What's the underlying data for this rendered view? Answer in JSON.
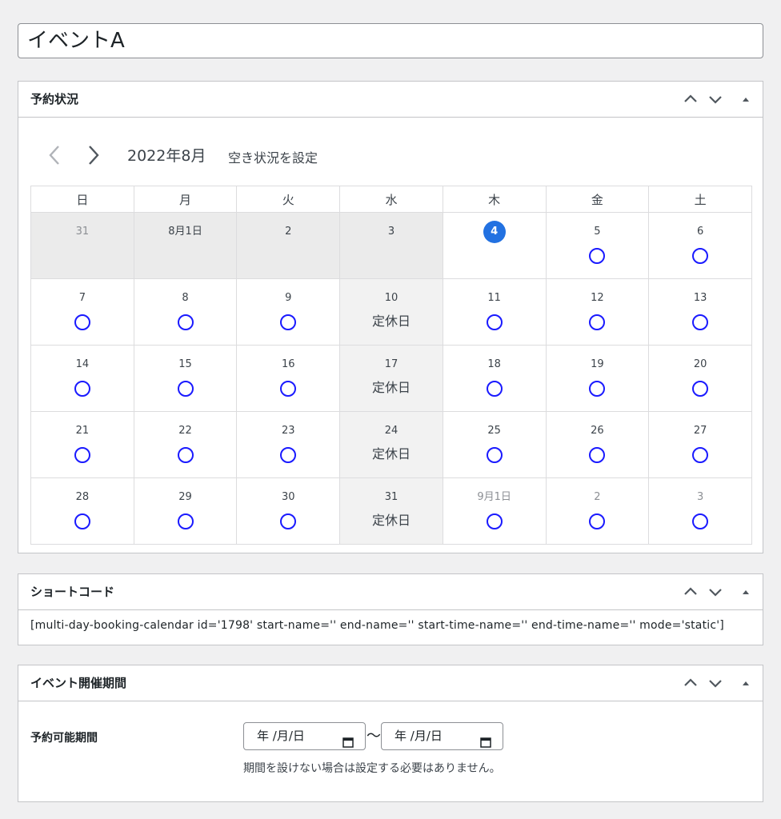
{
  "title_input": {
    "value": "イベントA"
  },
  "booking_box": {
    "title": "予約状況",
    "prev_label": "‹",
    "next_label": "›",
    "month_label": "2022年8月",
    "availability_link": "空き状況を設定",
    "weekdays": [
      "日",
      "月",
      "火",
      "水",
      "木",
      "金",
      "土"
    ],
    "weeks": [
      [
        {
          "day": "31",
          "status": "past",
          "muted": true
        },
        {
          "day": "8月1日",
          "status": "past"
        },
        {
          "day": "2",
          "status": "past"
        },
        {
          "day": "3",
          "status": "past"
        },
        {
          "day": "4",
          "status": "today"
        },
        {
          "day": "5",
          "status": "available"
        },
        {
          "day": "6",
          "status": "available"
        }
      ],
      [
        {
          "day": "7",
          "status": "available"
        },
        {
          "day": "8",
          "status": "available"
        },
        {
          "day": "9",
          "status": "available"
        },
        {
          "day": "10",
          "status": "closed",
          "label": "定休日"
        },
        {
          "day": "11",
          "status": "available"
        },
        {
          "day": "12",
          "status": "available"
        },
        {
          "day": "13",
          "status": "available"
        }
      ],
      [
        {
          "day": "14",
          "status": "available"
        },
        {
          "day": "15",
          "status": "available"
        },
        {
          "day": "16",
          "status": "available"
        },
        {
          "day": "17",
          "status": "closed",
          "label": "定休日"
        },
        {
          "day": "18",
          "status": "available"
        },
        {
          "day": "19",
          "status": "available"
        },
        {
          "day": "20",
          "status": "available"
        }
      ],
      [
        {
          "day": "21",
          "status": "available"
        },
        {
          "day": "22",
          "status": "available"
        },
        {
          "day": "23",
          "status": "available"
        },
        {
          "day": "24",
          "status": "closed",
          "label": "定休日"
        },
        {
          "day": "25",
          "status": "available"
        },
        {
          "day": "26",
          "status": "available"
        },
        {
          "day": "27",
          "status": "available"
        }
      ],
      [
        {
          "day": "28",
          "status": "available"
        },
        {
          "day": "29",
          "status": "available"
        },
        {
          "day": "30",
          "status": "available"
        },
        {
          "day": "31",
          "status": "closed",
          "label": "定休日"
        },
        {
          "day": "9月1日",
          "status": "available",
          "muted": true
        },
        {
          "day": "2",
          "status": "available",
          "muted": true
        },
        {
          "day": "3",
          "status": "available",
          "muted": true
        }
      ]
    ]
  },
  "shortcode_box": {
    "title": "ショートコード",
    "shortcode": "[multi-day-booking-calendar id='1798' start-name='' end-name='' start-time-name='' end-time-name='' mode='static']"
  },
  "period_box": {
    "title": "イベント開催期間",
    "label": "予約可能期間",
    "start_date_placeholder": "年 /月/日",
    "separator": "〜",
    "end_date_placeholder": "年 /月/日",
    "note": "期間を設けない場合は設定する必要はありません。"
  },
  "icons": {
    "move_up": "chevron-up-icon",
    "move_down": "chevron-down-icon",
    "toggle": "triangle-up-icon",
    "calendar": "calendar-icon"
  },
  "colors": {
    "available_circle": "#1a1aff",
    "today_badge": "#2271e1",
    "past_bg": "#ebebeb",
    "holiday_bg": "#f2f2f2"
  }
}
